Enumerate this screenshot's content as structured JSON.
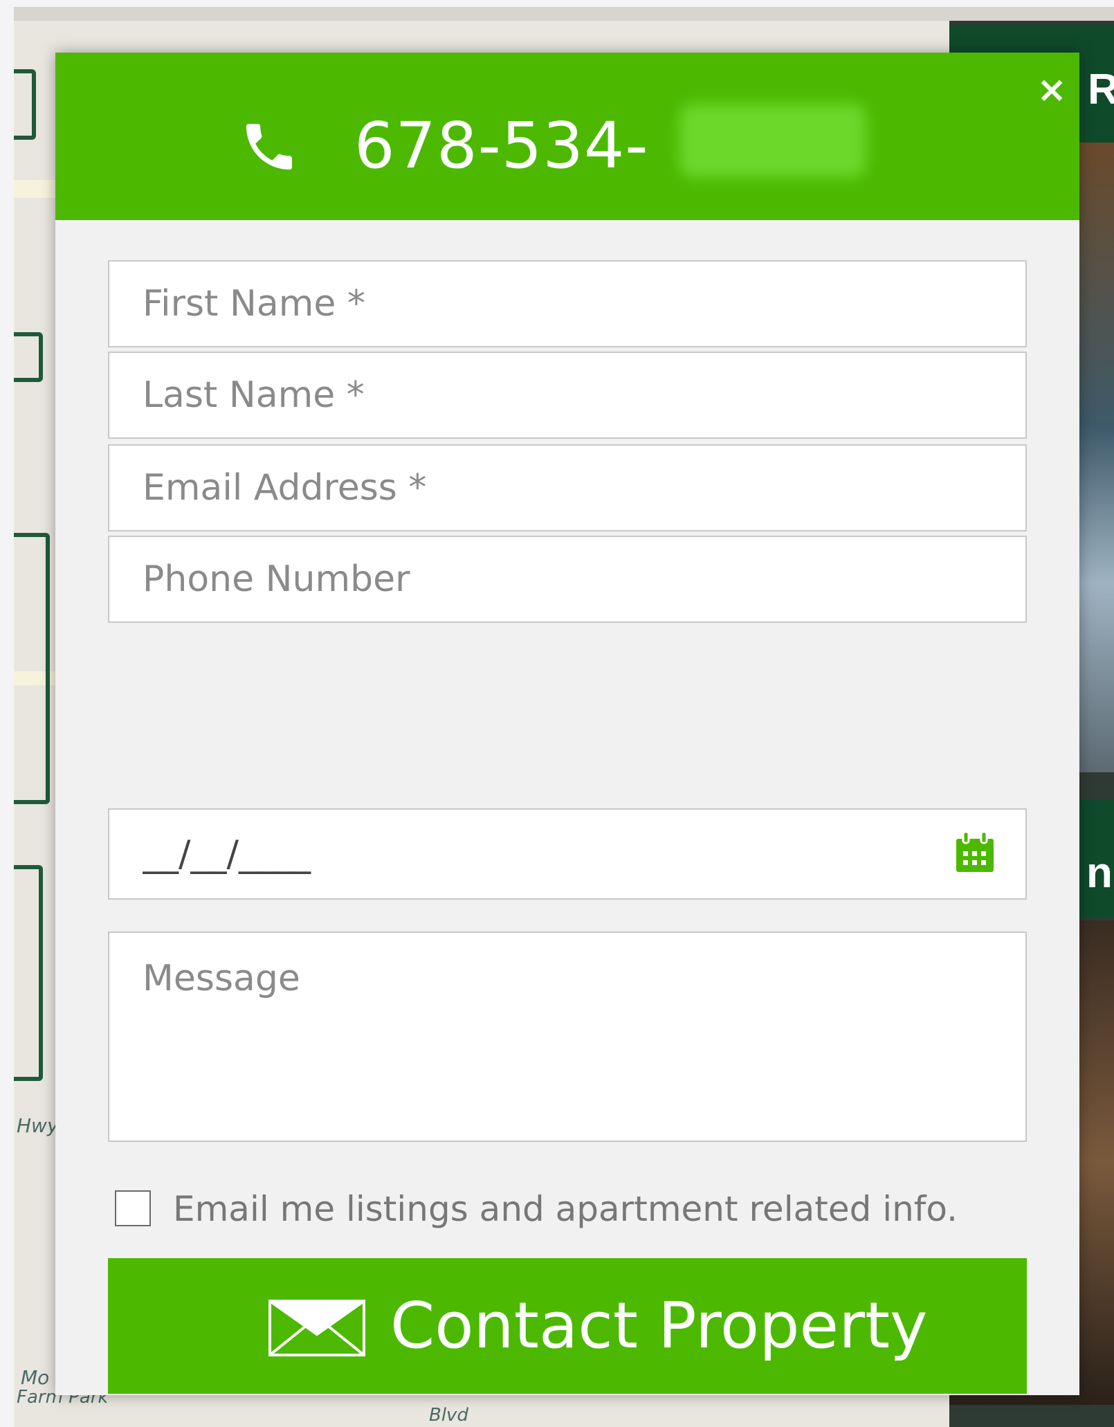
{
  "background": {
    "map_labels": [
      "Hwy",
      "Mo",
      "Farm Park",
      "Blvd"
    ],
    "panel_letters": [
      "R",
      "n"
    ]
  },
  "modal": {
    "phone": "678-534-",
    "close_label": "×",
    "form": {
      "first_name_placeholder": "First Name *",
      "last_name_placeholder": "Last Name *",
      "email_placeholder": "Email Address *",
      "phone_placeholder": "Phone Number",
      "date_placeholder": "__/__/____",
      "message_placeholder": "Message",
      "opt_in_label": "Email me listings and apartment related info.",
      "submit_label": "Contact Property"
    },
    "icons": {
      "phone": "phone-icon",
      "close": "close-icon",
      "calendar": "calendar-icon",
      "envelope": "envelope-icon"
    },
    "colors": {
      "brand_green": "#4cb900",
      "dark_green": "#0f4a2b",
      "text_muted": "#8a8a8a"
    }
  }
}
